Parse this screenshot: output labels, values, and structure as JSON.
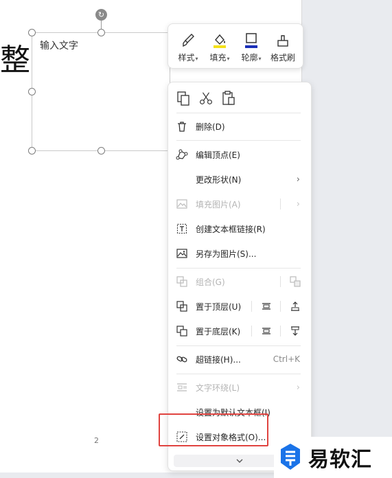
{
  "document": {
    "partial_char": "整",
    "textbox_text": "输入文字",
    "page_number": "2"
  },
  "mini_toolbar": {
    "style_label": "样式",
    "fill_label": "填充",
    "outline_label": "轮廓",
    "format_painter_label": "格式刷",
    "fill_color": "#f4e11a",
    "outline_color": "#1a2fb8"
  },
  "context_menu": {
    "delete": "删除(D)",
    "edit_points": "编辑顶点(E)",
    "change_shape": "更改形状(N)",
    "fill_picture": "填充图片(A)",
    "create_textbox_link": "创建文本框链接(R)",
    "save_as_picture": "另存为图片(S)...",
    "group": "组合(G)",
    "bring_to_front": "置于顶层(U)",
    "send_to_back": "置于底层(K)",
    "hyperlink": "超链接(H)...",
    "hyperlink_shortcut": "Ctrl+K",
    "text_wrap": "文字环绕(L)",
    "set_default_textbox": "设置为默认文本框(I)",
    "format_object": "设置对象格式(O)..."
  },
  "watermark": {
    "text": "易软汇",
    "accent": "#1a73e8"
  },
  "colors": {
    "highlight": "#e0433f",
    "disabled_text": "#b4b4b4"
  }
}
